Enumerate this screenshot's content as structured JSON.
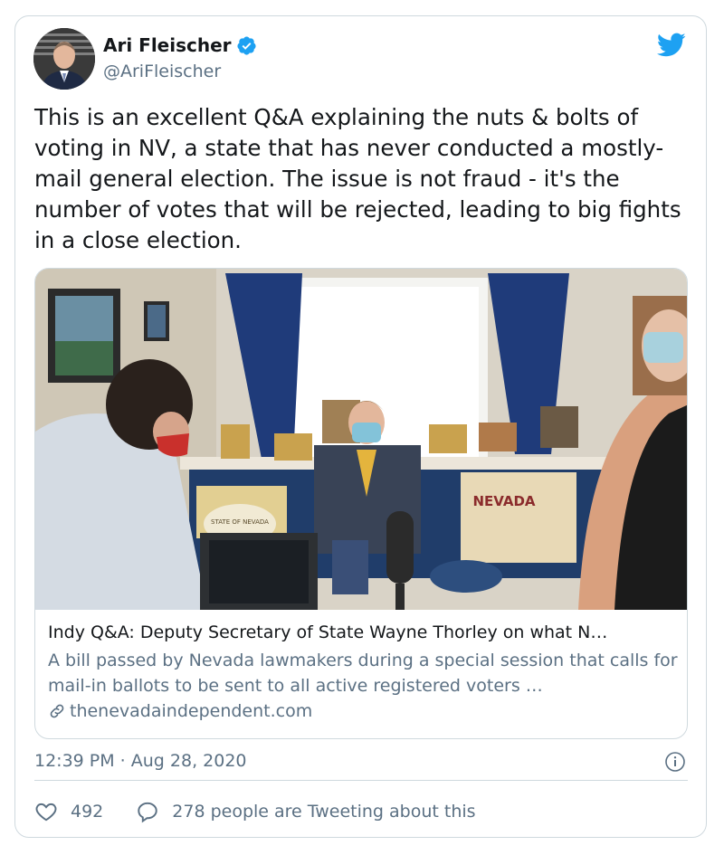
{
  "author": {
    "name": "Ari Fleischer",
    "handle": "@AriFleischer",
    "verified": true
  },
  "tweet": {
    "text": "This is an excellent Q&A explaining the nuts & bolts of voting in NV, a state that has never conducted a mostly-mail general election. The issue is not fraud - it's the number of votes that will be rejected, leading to big fights in a close election.",
    "timestamp": "12:39 PM · Aug 28, 2020"
  },
  "link_card": {
    "title": "Indy Q&A: Deputy Secretary of State Wayne Thorley on what N…",
    "description": "A bill passed by Nevada lawmakers during a special session that calls for mail-in ballots to be sent to all active registered voters …",
    "domain": "thenevadaindependent.com",
    "pillow_text": "NEVADA",
    "seal_text": "STATE OF NEVADA"
  },
  "engagement": {
    "likes": "492",
    "conversation": "278 people are Tweeting about this"
  },
  "icons": {
    "verified": "verified-badge-icon",
    "bird": "twitter-bird-icon",
    "link": "link-icon",
    "info": "info-icon",
    "like": "heart-icon",
    "reply": "speech-bubble-icon"
  },
  "colors": {
    "twitter_blue": "#1da1f2",
    "secondary_text": "#5b7083",
    "border": "#cfd9de"
  }
}
